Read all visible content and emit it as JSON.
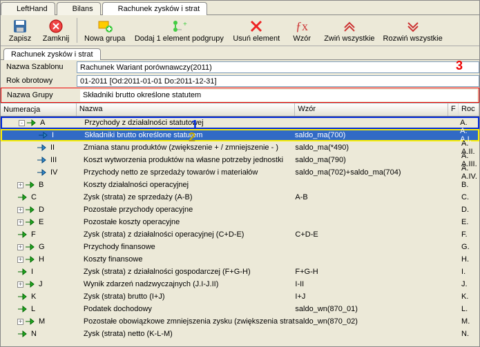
{
  "tabs": {
    "t1": "LeftHand",
    "t2": "Bilans",
    "t3": "Rachunek zysków i strat"
  },
  "toolbar": {
    "save": "Zapisz",
    "close": "Zamknij",
    "newgroup": "Nowa grupa",
    "addsub": "Dodaj 1 element podgrupy",
    "delete": "Usuń element",
    "wzor": "Wzór",
    "collapse": "Zwiń wszystkie",
    "expand": "Rozwiń wszystkie"
  },
  "subtab": "Rachunek zysków i strat",
  "form": {
    "lbl_szablon": "Nazwa Szablonu",
    "szablon": "Rachunek Wariant porównawczy(2011)",
    "lbl_rok": "Rok obrotowy",
    "rok": "01-2011 [Od:2011-01-01 Do:2011-12-31]",
    "lbl_grupa": "Nazwa Grupy",
    "grupa": "Składniki brutto określone statutem"
  },
  "annot": {
    "a1": "1",
    "a2": "2",
    "a3": "3"
  },
  "head": {
    "num": "Numeracja",
    "naz": "Nazwa",
    "wz": "Wzór",
    "f": "F",
    "r": "Roc"
  },
  "rows": [
    {
      "depth": 0,
      "exp": "-",
      "num": "A",
      "naz": "Przychody z działalności statutowej",
      "wz": "",
      "r": "A.",
      "sel": false,
      "box": "blue"
    },
    {
      "depth": 2,
      "exp": "",
      "num": "I",
      "naz": "Składniki brutto określone statutem",
      "wz": "saldo_ma(700)",
      "r": "A. A.I.",
      "sel": true,
      "box": "yellow"
    },
    {
      "depth": 2,
      "exp": "",
      "num": "II",
      "naz": "Zmiana stanu produktów (zwiększenie + / zmniejszenie - )",
      "wz": "saldo_ma(*490)",
      "r": "A. A.II.",
      "sel": false,
      "box": ""
    },
    {
      "depth": 2,
      "exp": "",
      "num": "III",
      "naz": " Koszt wytworzenia produktów na własne potrzeby jednostki",
      "wz": "saldo_ma(790)",
      "r": "A. A.III.",
      "sel": false,
      "box": ""
    },
    {
      "depth": 2,
      "exp": "",
      "num": "IV",
      "naz": "Przychody netto ze sprzedaży towarów i materiałów",
      "wz": "saldo_ma(702)+saldo_ma(704)",
      "r": "A. A.IV.",
      "sel": false,
      "box": ""
    },
    {
      "depth": 0,
      "exp": "+",
      "num": "B",
      "naz": "Koszty działalności operacyjnej",
      "wz": "",
      "r": "B.",
      "sel": false,
      "box": ""
    },
    {
      "depth": 0,
      "exp": "",
      "num": "C",
      "naz": "Zysk (strata) ze sprzedaży (A-B)",
      "wz": "A-B",
      "r": "C.",
      "sel": false,
      "box": ""
    },
    {
      "depth": 0,
      "exp": "+",
      "num": "D",
      "naz": "Pozostałe przychody operacyjne",
      "wz": "",
      "r": "D.",
      "sel": false,
      "box": ""
    },
    {
      "depth": 0,
      "exp": "+",
      "num": "E",
      "naz": "Pozostałe koszty operacyjne",
      "wz": "",
      "r": "E.",
      "sel": false,
      "box": ""
    },
    {
      "depth": 0,
      "exp": "",
      "num": "F",
      "naz": "Zysk (strata) z działalności operacyjnej (C+D-E)",
      "wz": "C+D-E",
      "r": "F.",
      "sel": false,
      "box": ""
    },
    {
      "depth": 0,
      "exp": "+",
      "num": "G",
      "naz": "Przychody finansowe",
      "wz": "",
      "r": "G.",
      "sel": false,
      "box": ""
    },
    {
      "depth": 0,
      "exp": "+",
      "num": "H",
      "naz": "Koszty finansowe",
      "wz": "",
      "r": "H.",
      "sel": false,
      "box": ""
    },
    {
      "depth": 0,
      "exp": "",
      "num": "I",
      "naz": "Zysk (strata) z działalności gospodarczej (F+G-H)",
      "wz": "F+G-H",
      "r": "I.",
      "sel": false,
      "box": ""
    },
    {
      "depth": 0,
      "exp": "+",
      "num": "J",
      "naz": "Wynik zdarzeń nadzwyczajnych (J.I-J.II)",
      "wz": "I-II",
      "r": "J.",
      "sel": false,
      "box": ""
    },
    {
      "depth": 0,
      "exp": "",
      "num": "K",
      "naz": " Zysk (strata) brutto (I+J)",
      "wz": "I+J",
      "r": "K.",
      "sel": false,
      "box": ""
    },
    {
      "depth": 0,
      "exp": "",
      "num": "L",
      "naz": "Podatek dochodowy",
      "wz": "saldo_wn(870_01)",
      "r": "L.",
      "sel": false,
      "box": ""
    },
    {
      "depth": 0,
      "exp": "+",
      "num": "M",
      "naz": "Pozostałe obowiązkowe zmniejszenia zysku (zwiększenia straty)",
      "wz": "saldo_wn(870_02)",
      "r": "M.",
      "sel": false,
      "box": ""
    },
    {
      "depth": 0,
      "exp": "",
      "num": "N",
      "naz": "Zysk (strata) netto (K-L-M)",
      "wz": "",
      "r": "N.",
      "sel": false,
      "box": ""
    }
  ]
}
